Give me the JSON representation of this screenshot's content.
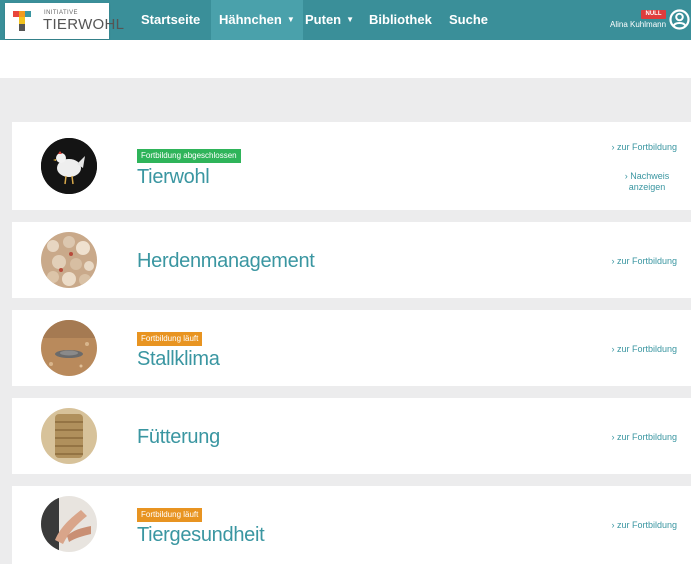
{
  "brand": {
    "small": "INITIATIVE",
    "main": "TIERWOHL"
  },
  "nav": {
    "items": [
      {
        "label": "Startseite"
      },
      {
        "label": "Hähnchen"
      },
      {
        "label": "Puten"
      },
      {
        "label": "Bibliothek"
      },
      {
        "label": "Suche"
      }
    ]
  },
  "user": {
    "badge": "NULL",
    "name": "Alina Kuhlmann"
  },
  "courses": [
    {
      "title": "Tierwohl",
      "status": "Fortbildung abgeschlossen",
      "status_color": "#2fb45a",
      "link": "› zur Fortbildung",
      "cert_link": "› Nachweis anzeigen"
    },
    {
      "title": "Herdenmanagement",
      "link": "› zur Fortbildung"
    },
    {
      "title": "Stallklima",
      "status": "Fortbildung läuft",
      "status_color": "#e89421",
      "link": "› zur Fortbildung"
    },
    {
      "title": "Fütterung",
      "link": "› zur Fortbildung"
    },
    {
      "title": "Tiergesundheit",
      "status": "Fortbildung läuft",
      "status_color": "#e89421",
      "link": "› zur Fortbildung"
    }
  ],
  "colors": {
    "nav": "#3a8f99",
    "nav_active": "#4aa1ab",
    "title": "#3a96a1"
  }
}
